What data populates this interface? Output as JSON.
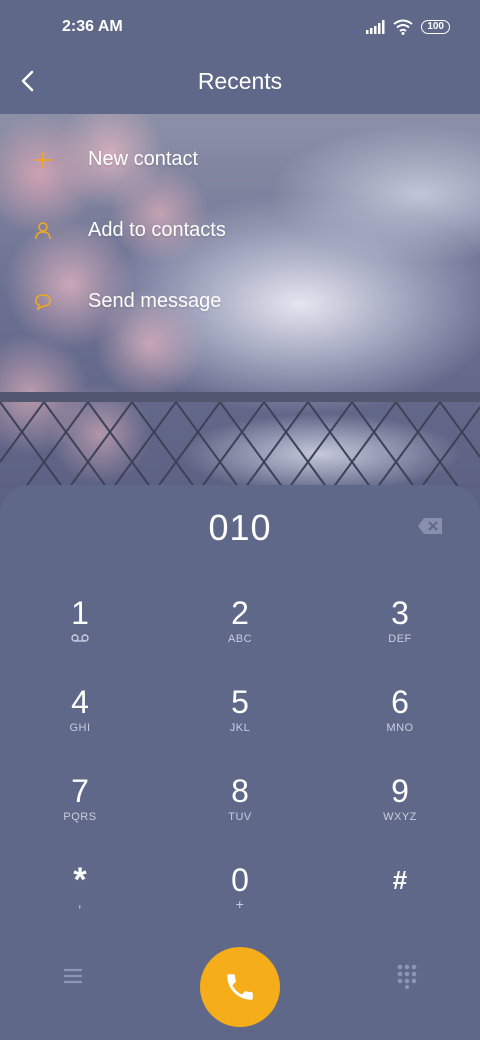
{
  "status_bar": {
    "time": "2:36 AM",
    "battery": "100"
  },
  "header": {
    "title": "Recents"
  },
  "menu": {
    "items": [
      {
        "label": "New contact",
        "icon": "plus-icon"
      },
      {
        "label": "Add to contacts",
        "icon": "person-icon"
      },
      {
        "label": "Send message",
        "icon": "message-bubble-icon"
      }
    ]
  },
  "dialer": {
    "number": "010",
    "keys": [
      {
        "digit": "1",
        "letters": "",
        "icon": "voicemail-icon"
      },
      {
        "digit": "2",
        "letters": "ABC"
      },
      {
        "digit": "3",
        "letters": "DEF"
      },
      {
        "digit": "4",
        "letters": "GHI"
      },
      {
        "digit": "5",
        "letters": "JKL"
      },
      {
        "digit": "6",
        "letters": "MNO"
      },
      {
        "digit": "7",
        "letters": "PQRS"
      },
      {
        "digit": "8",
        "letters": "TUV"
      },
      {
        "digit": "9",
        "letters": "WXYZ"
      },
      {
        "digit": "*",
        "letters": ","
      },
      {
        "digit": "0",
        "letters": "+"
      },
      {
        "digit": "#",
        "letters": ""
      }
    ]
  },
  "colors": {
    "background": "#5f6888",
    "accent": "#f5ad1a",
    "icon_accent": "#f2a81c"
  }
}
